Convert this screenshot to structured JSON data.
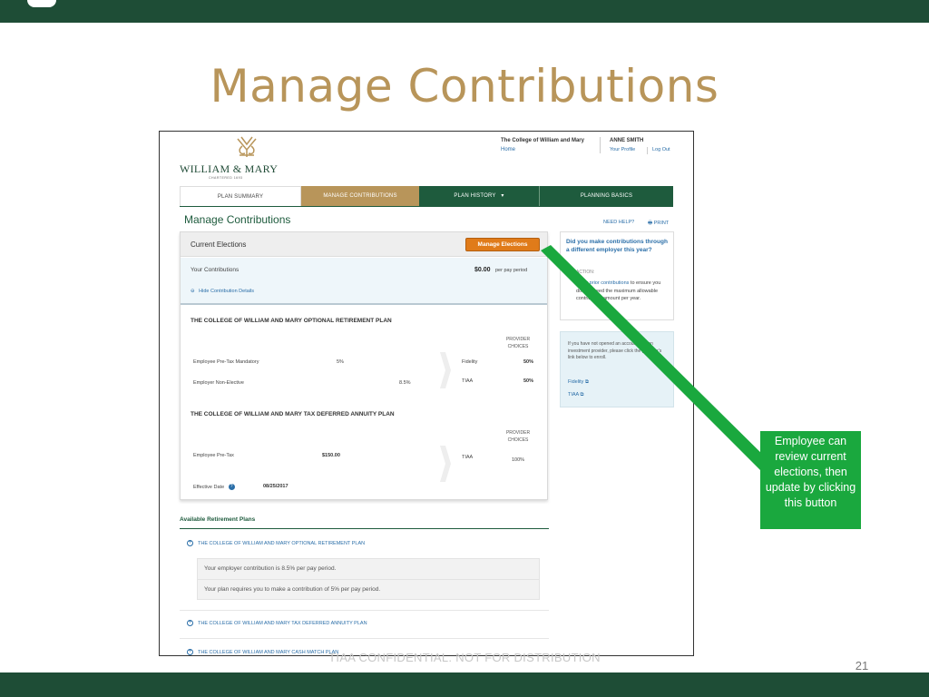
{
  "slide": {
    "title": "Manage Contributions",
    "footer": "TIAA CONFIDENTIAL. NOT FOR DISTRIBUTION",
    "page_number": "21",
    "callout": "Employee can review current elections, then update by clicking this button"
  },
  "colors": {
    "brand_green": "#1e4d36",
    "gold": "#b8955a",
    "button_orange": "#e07b1a",
    "callout_green": "#1aa83e",
    "link_blue": "#2a6ea8"
  },
  "site": {
    "logo_name": "WILLIAM & MARY",
    "logo_sub": "CHARTERED 1693",
    "college": "The College of William and Mary",
    "home": "Home",
    "user": "ANNE SMITH",
    "profile": "Your Profile",
    "logout": "Log Out"
  },
  "nav": {
    "tabs": [
      "PLAN SUMMARY",
      "MANAGE CONTRIBUTIONS",
      "PLAN HISTORY",
      "PLANNING BASICS"
    ]
  },
  "page": {
    "heading": "Manage Contributions",
    "need_help": "NEED HELP?",
    "print": "PRINT"
  },
  "elections": {
    "title": "Current Elections",
    "button": "Manage Elections",
    "your_contributions": "Your Contributions",
    "amount": "$0.00",
    "per_period": "per pay period",
    "hide_details": "Hide Contribution Details",
    "plan1": {
      "title": "THE COLLEGE OF WILLIAM AND MARY OPTIONAL RETIREMENT PLAN",
      "provider_header": "PROVIDER CHOICES",
      "rows": [
        {
          "label": "Employee Pre-Tax Mandatory",
          "value": "5%",
          "provider": "Fidelity",
          "pct": "50%"
        },
        {
          "label": "Employer Non-Elective",
          "value": "8.5%",
          "provider": "TIAA",
          "pct": "50%"
        }
      ]
    },
    "plan2": {
      "title": "THE COLLEGE OF WILLIAM AND MARY TAX DEFERRED ANNUITY PLAN",
      "provider_header": "PROVIDER CHOICES",
      "rows": [
        {
          "label": "Employee Pre-Tax",
          "value": "$150.00",
          "provider": "TIAA",
          "pct": "100%"
        }
      ]
    },
    "effective_label": "Effective Date",
    "effective_date": "08/25/2017"
  },
  "sidebar": {
    "prior_title": "Did you make contributions through a different employer this year?",
    "action_label": "ACTION:",
    "action_link": "Enter prior contributions",
    "action_text": "to ensure you don't exceed the maximum allowable contribution amount per year.",
    "open_text": "If you have not opened an account with an investment provider, please click the provider's link below to enroll.",
    "links": [
      "Fidelity",
      "TIAA"
    ]
  },
  "available": {
    "title": "Available Retirement Plans",
    "plans": [
      "THE COLLEGE OF WILLIAM AND MARY OPTIONAL RETIREMENT PLAN",
      "THE COLLEGE OF WILLIAM AND MARY TAX DEFERRED ANNUITY PLAN",
      "THE COLLEGE OF WILLIAM AND MARY CASH MATCH PLAN"
    ],
    "notes": [
      "Your employer contribution is 8.5% per pay period.",
      "Your plan requires you to make a contribution of 5% per pay period."
    ]
  }
}
